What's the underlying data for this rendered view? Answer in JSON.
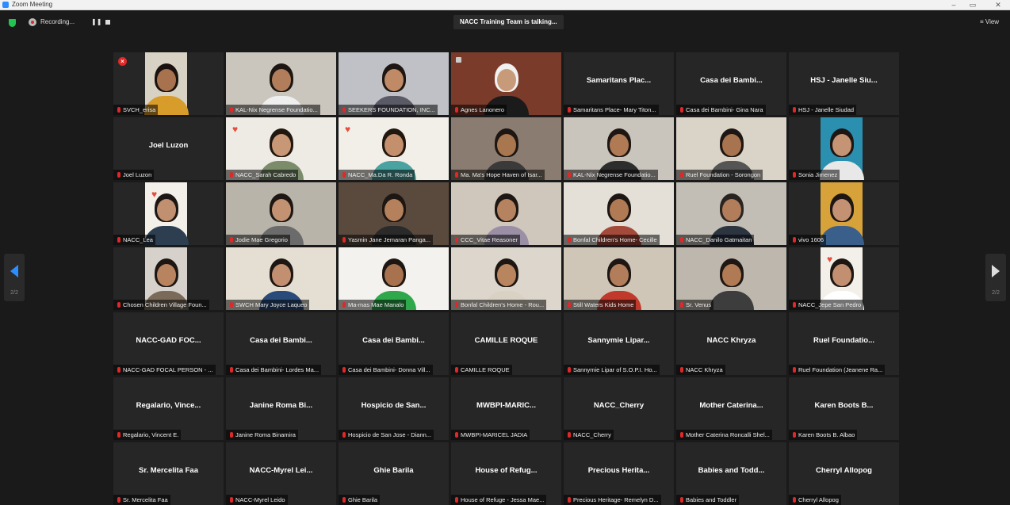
{
  "window": {
    "title": "Zoom Meeting"
  },
  "toolbar": {
    "recording_label": "Recording...",
    "pause_symbol": "❚❚",
    "talking_banner": "NACC Training Team is talking...",
    "view_label": "≡ View",
    "prev_page": "2/2",
    "next_page": "2/2",
    "icons": [
      "security-shield-icon",
      "recording-icon",
      "pause-icon",
      "stop-icon",
      "view-icon",
      "chevron-left-icon",
      "chevron-right-icon"
    ]
  },
  "colors": {
    "background": "#1a1a1a",
    "tile": "#262626",
    "muted_mic": "#e02828",
    "accent_blue": "#2d8cff",
    "security_green": "#23c552"
  },
  "participants": [
    {
      "label": "SVCH_erisa",
      "video": true,
      "bg": "#d8d2c4",
      "skin": "#a8724f",
      "hair": "#1a120e",
      "shirt": "#d89c2a",
      "x": true
    },
    {
      "label": "KAL-Nix Negrense Foundatio...",
      "video": true,
      "bg": "#cbc6bd",
      "skin": "#b27d5b",
      "hair": "#1d1612",
      "shirt": "#eeeeee"
    },
    {
      "label": "SEEKERS FOUNDATION, INC...",
      "video": true,
      "bg": "#bfc1c6",
      "skin": "#c08a66",
      "hair": "#1d1612",
      "shirt": "#5a5a66"
    },
    {
      "label": "Agnes Lanonero",
      "video": true,
      "bg": "#7a3b2b",
      "skin": "#c79a7a",
      "hair": "#f0f0f0",
      "shirt": "#1b1b1b",
      "cam": true
    },
    {
      "name": "Samaritans Plac...",
      "label": "Samaritans Place- Mary Titon..."
    },
    {
      "name": "Casa dei Bambi...",
      "label": "Casa dei Bambini- Gina Nara"
    },
    {
      "name": "HSJ - Janelle Siu...",
      "label": "HSJ - Janelle Siudad"
    },
    {
      "name": "Joel Luzon",
      "label": "Joel Luzon"
    },
    {
      "label": "NACC_Sarah Cabredo",
      "video": true,
      "bg": "#eeeae4",
      "skin": "#c89876",
      "hair": "#20170f",
      "shirt": "#7a8c6a",
      "heart": true
    },
    {
      "label": "NACC_Ma.Da R. Ronda",
      "video": true,
      "bg": "#f2efe9",
      "skin": "#c48f6d",
      "hair": "#20170f",
      "shirt": "#4aa3a0",
      "heart": true
    },
    {
      "label": "Ma. Ma's Hope Haven of Isar...",
      "video": true,
      "bg": "#8a7c70",
      "skin": "#a8764f",
      "hair": "#1d1612",
      "shirt": "#3a3a3a"
    },
    {
      "label": "KAL-Nix Negrense Foundatio...",
      "video": true,
      "bg": "#c9c4bc",
      "skin": "#b07a55",
      "hair": "#1d1612",
      "shirt": "#2d2d2d"
    },
    {
      "label": "Ruel Foundation - Sorongon",
      "video": true,
      "bg": "#d9d3c8",
      "skin": "#a8744f",
      "hair": "#1d1612",
      "shirt": "#555555"
    },
    {
      "label": "Sonia Jimenez",
      "video": true,
      "bg": "#2b8fb0",
      "skin": "#c59474",
      "hair": "#1d1612",
      "shirt": "#e8e8e8"
    },
    {
      "label": "NACC_Lea",
      "video": true,
      "bg": "#f3f0ea",
      "skin": "#c09070",
      "hair": "#1d1612",
      "shirt": "#2c3e50",
      "heart": true
    },
    {
      "label": "Jodie Mae Gregorio",
      "video": true,
      "bg": "#b9b4aa",
      "skin": "#c39272",
      "hair": "#1d1612",
      "shirt": "#6b6b6b"
    },
    {
      "label": "Yasmin Jane Jemaran Panga...",
      "video": true,
      "bg": "#5a4a3e",
      "skin": "#b5815c",
      "hair": "#1d1612",
      "shirt": "#2a2a2a"
    },
    {
      "label": "CCC_Vitae Reasoner",
      "video": true,
      "bg": "#cfc7bc",
      "skin": "#b5835f",
      "hair": "#1d1612",
      "shirt": "#9b8fa6"
    },
    {
      "label": "Bonfal Children's Home- Cecille",
      "video": true,
      "bg": "#e4e0d8",
      "skin": "#b07a55",
      "hair": "#1d1612",
      "shirt": "#a44a3a"
    },
    {
      "label": "NACC_Danilo Gatmaitan",
      "video": true,
      "bg": "#c2beb6",
      "skin": "#b27d5b",
      "hair": "#2a2420",
      "shirt": "#2c3440"
    },
    {
      "label": "vivo 1606",
      "video": true,
      "bg": "#d8a23a",
      "skin": "#c49272",
      "hair": "#1d1612",
      "shirt": "#3a5f8a"
    },
    {
      "label": "Chosen Children Village Foun...",
      "video": true,
      "bg": "#d6d2cb",
      "skin": "#b8845f",
      "hair": "#1d1612",
      "shirt": "#7a6a5a"
    },
    {
      "label": "SWCH Mary Joyce Laqueo",
      "video": true,
      "bg": "#e4dfd2",
      "skin": "#c29070",
      "hair": "#1d1612",
      "shirt": "#2a4a7a"
    },
    {
      "label": "Ma-mas Mae Manalo",
      "video": true,
      "bg": "#f4f2ee",
      "skin": "#a8724f",
      "hair": "#1d1612",
      "shirt": "#2ea84a"
    },
    {
      "label": "Bonfal Children's Home - Rou...",
      "video": true,
      "bg": "#ddd6cc",
      "skin": "#b9855f",
      "hair": "#1d1612",
      "shirt": "#d9d2c4"
    },
    {
      "label": "Still Waters Kids Home",
      "video": true,
      "bg": "#cfc6b8",
      "skin": "#b27d5b",
      "hair": "#1d1612",
      "shirt": "#c0392b"
    },
    {
      "label": "Sr. Venus",
      "video": true,
      "bg": "#bdb7ad",
      "skin": "#b07a55",
      "hair": "#1d1612",
      "shirt": "#3d3d3d"
    },
    {
      "label": "NACC_Jepe San Pedro",
      "video": true,
      "bg": "#f3f0ea",
      "skin": "#c29070",
      "hair": "#1d1612",
      "shirt": "#ffffff",
      "heart": true
    },
    {
      "name": "NACC-GAD FOC...",
      "label": "NACC-GAD FOCAL PERSON - ..."
    },
    {
      "name": "Casa dei Bambi...",
      "label": "Casa dei Bambini- Lordes Ma..."
    },
    {
      "name": "Casa dei Bambi...",
      "label": "Casa dei Bambini- Donna Vill..."
    },
    {
      "name": "CAMILLE ROQUE",
      "label": "CAMILLE ROQUE"
    },
    {
      "name": "Sannymie Lipar...",
      "label": "Sannymie Lipar of S.O.P.I. Ho..."
    },
    {
      "name": "NACC Khryza",
      "label": "NACC Khryza"
    },
    {
      "name": "Ruel Foundatio...",
      "label": "Ruel Foundation (Jeanene Ra..."
    },
    {
      "name": "Regalario, Vince...",
      "label": "Regalario, Vincent E."
    },
    {
      "name": "Janine Roma Bi...",
      "label": "Janine Roma Binamira"
    },
    {
      "name": "Hospicio de San...",
      "label": "Hospicio de San Jose - Diann..."
    },
    {
      "name": "MWBPI-MARIC...",
      "label": "MWBPI-MARICEL JADIA"
    },
    {
      "name": "NACC_Cherry",
      "label": "NACC_Cherry"
    },
    {
      "name": "Mother Caterina...",
      "label": "Mother Caterina Roncalli Shel..."
    },
    {
      "name": "Karen Boots B...",
      "label": "Karen Boots B. Albao"
    },
    {
      "name": "Sr. Mercelita Faa",
      "label": "Sr. Mercelita Faa"
    },
    {
      "name": "NACC-Myrel Lei...",
      "label": "NACC-Myrel Leido"
    },
    {
      "name": "Ghie Barila",
      "label": "Ghie Barila"
    },
    {
      "name": "House of Refug...",
      "label": "House of Refuge - Jessa Mae..."
    },
    {
      "name": "Precious Herita...",
      "label": "Precious Heritage- Remelyn D..."
    },
    {
      "name": "Babies and Todd...",
      "label": "Babies and Toddler"
    },
    {
      "name": "Cherryl Allopog",
      "label": "Cherryl Allopog"
    }
  ]
}
